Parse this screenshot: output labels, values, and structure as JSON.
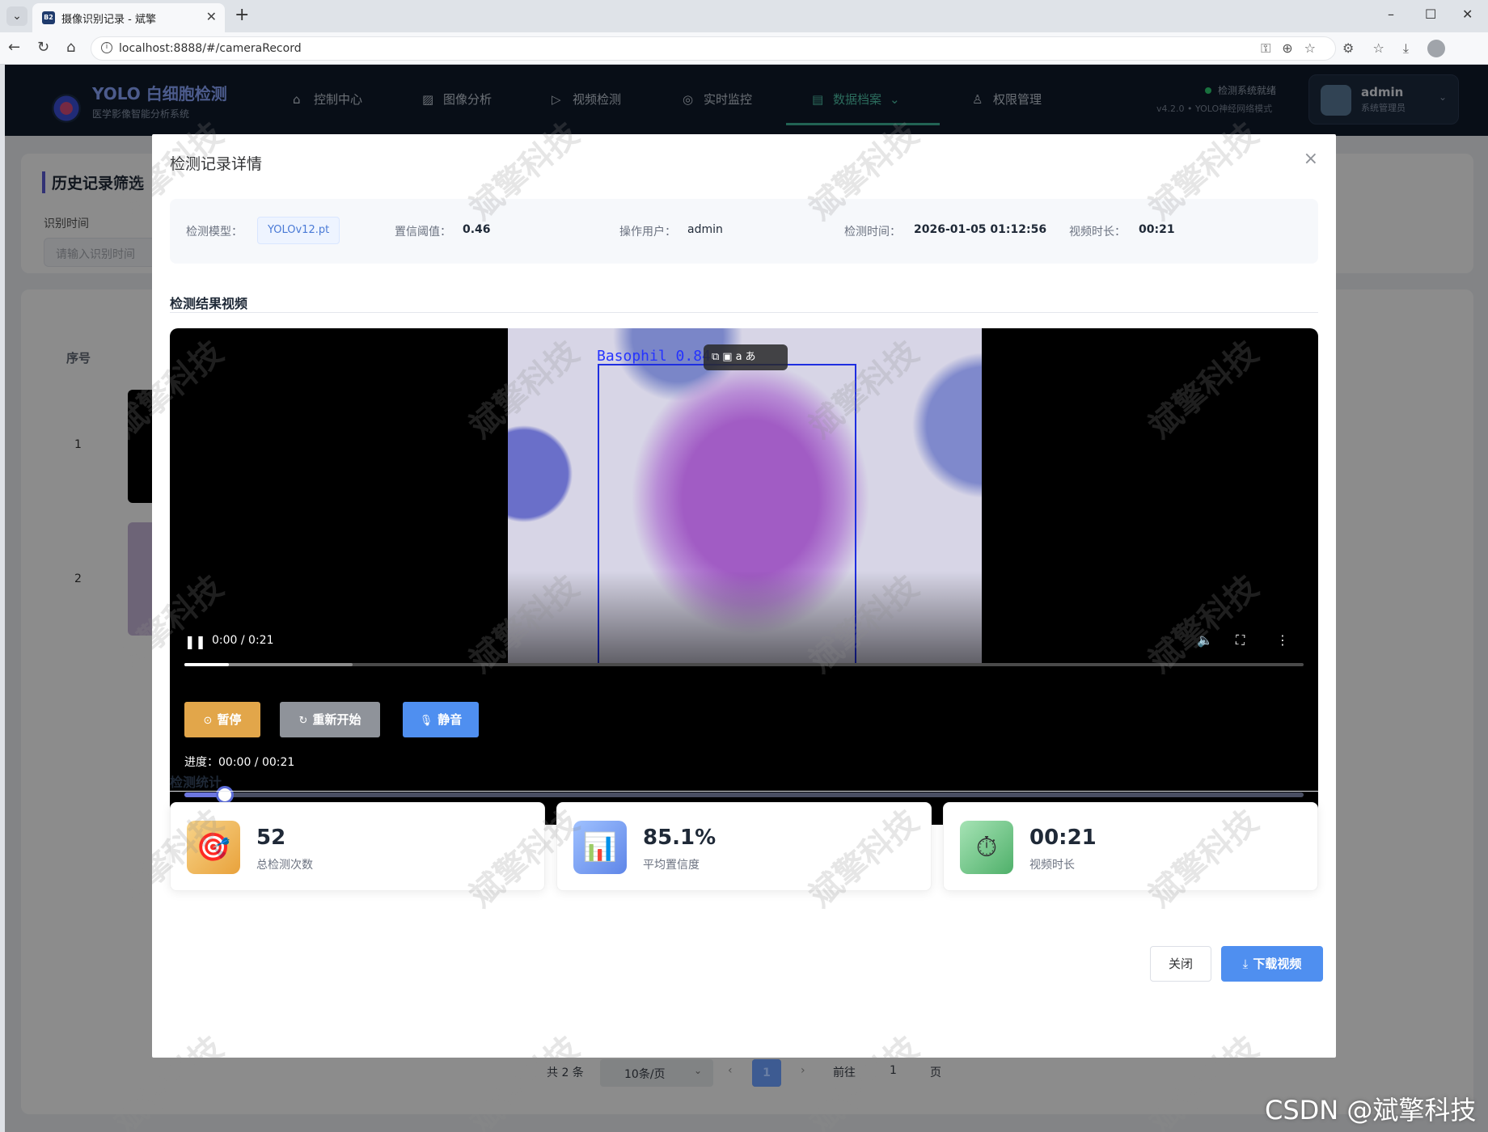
{
  "browser": {
    "tab_title": "摄像识别记录 - 斌擎",
    "tab_favicon": "B2",
    "url": "localhost:8888/#/cameraRecord"
  },
  "header": {
    "logo_title": "YOLO 白细胞检测",
    "logo_subtitle": "医学影像智能分析系统",
    "nav": [
      {
        "label": "控制中心",
        "icon": "home-icon"
      },
      {
        "label": "图像分析",
        "icon": "image-icon"
      },
      {
        "label": "视频检测",
        "icon": "play-circle-icon"
      },
      {
        "label": "实时监控",
        "icon": "camera-icon"
      },
      {
        "label": "数据档案",
        "icon": "document-icon",
        "active": true
      },
      {
        "label": "权限管理",
        "icon": "user-icon"
      }
    ],
    "status_text": "检测系统就绪",
    "version_text": "v4.2.0 • YOLO神经网络模式",
    "user_name": "admin",
    "user_role": "系统管理员"
  },
  "background": {
    "filter_title": "历史记录筛选",
    "filter_label": "识别时间",
    "filter_placeholder": "请输入识别时间",
    "col_index": "序号",
    "rows": [
      "1",
      "2"
    ],
    "pager": {
      "total": "共 2 条",
      "page_size": "10条/页",
      "current_page": "1",
      "goto_label": "前往",
      "goto_value": "1",
      "page_suffix": "页"
    }
  },
  "dialog": {
    "title": "检测记录详情",
    "info": {
      "model_label": "检测模型：",
      "model_value": "YOLOv12.pt",
      "conf_label": "置信阈值：",
      "conf_value": "0.46",
      "user_label": "操作用户：",
      "user_value": "admin",
      "time_label": "检测时间：",
      "time_value": "2026-01-05 01:12:56",
      "duration_label": "视频时长：",
      "duration_value": "00:21"
    },
    "video_section_title": "检测结果视频",
    "video": {
      "detection_label": "Basophil  0.84",
      "time_display": "0:00 / 0:21",
      "played_fraction": 0.04,
      "buffered_fraction": 0.15
    },
    "controls": {
      "pause_label": "暂停",
      "restart_label": "重新开始",
      "mute_label": "静音",
      "progress_text": "进度：00:00 / 00:21",
      "slider_fraction": 0.036
    },
    "stats_section_title": "检测统计",
    "stats": [
      {
        "value": "52",
        "label": "总检测次数",
        "icon": "target-icon"
      },
      {
        "value": "85.1%",
        "label": "平均置信度",
        "icon": "bar-chart-icon"
      },
      {
        "value": "00:21",
        "label": "视频时长",
        "icon": "stopwatch-icon"
      }
    ],
    "close_label": "关闭",
    "download_label": "下载视频"
  },
  "watermark_text": "斌擎科技",
  "csdn_watermark": "CSDN @斌擎科技",
  "colors": {
    "header_bg": "#0f1b2b",
    "accent_teal": "#3fb59a",
    "pause_btn": "#e2a64a",
    "restart_btn": "#8f939a",
    "mute_btn": "#4f8ff0",
    "primary": "#4f8ff0",
    "bbox": "#1e2ee0"
  }
}
